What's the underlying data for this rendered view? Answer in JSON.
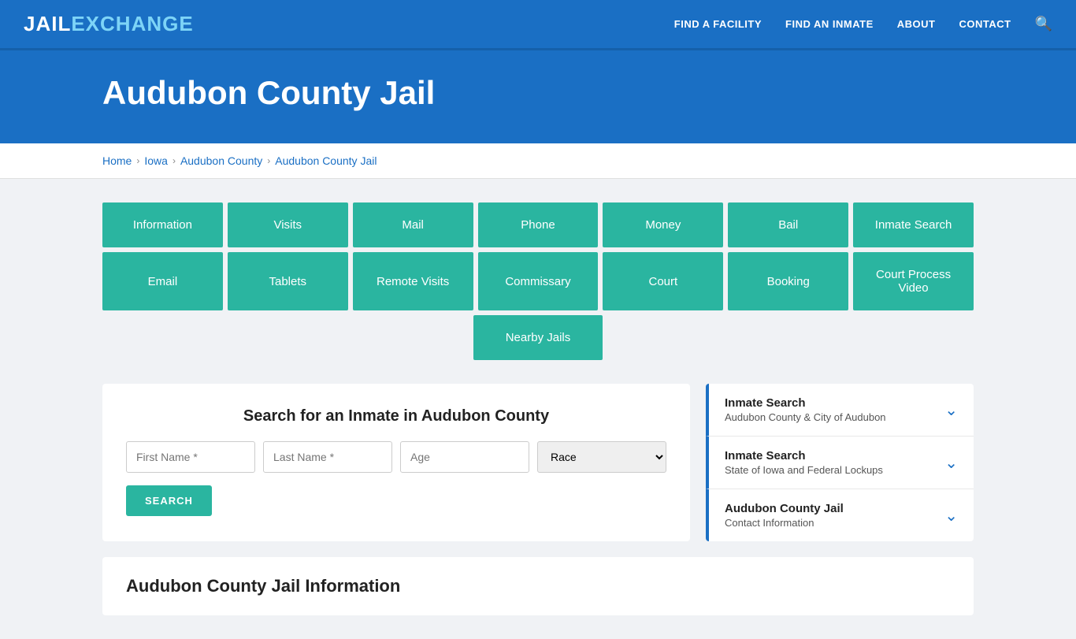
{
  "header": {
    "logo_jail": "JAIL",
    "logo_exchange": "EXCHANGE",
    "nav": [
      {
        "label": "FIND A FACILITY",
        "name": "find-facility"
      },
      {
        "label": "FIND AN INMATE",
        "name": "find-inmate"
      },
      {
        "label": "ABOUT",
        "name": "about"
      },
      {
        "label": "CONTACT",
        "name": "contact"
      }
    ]
  },
  "hero": {
    "title": "Audubon County Jail"
  },
  "breadcrumb": {
    "items": [
      "Home",
      "Iowa",
      "Audubon County",
      "Audubon County Jail"
    ]
  },
  "grid_row1": [
    "Information",
    "Visits",
    "Mail",
    "Phone",
    "Money",
    "Bail",
    "Inmate Search"
  ],
  "grid_row2": [
    "Email",
    "Tablets",
    "Remote Visits",
    "Commissary",
    "Court",
    "Booking",
    "Court Process Video"
  ],
  "grid_row3": "Nearby Jails",
  "search": {
    "title": "Search for an Inmate in Audubon County",
    "first_name_placeholder": "First Name *",
    "last_name_placeholder": "Last Name *",
    "age_placeholder": "Age",
    "race_placeholder": "Race",
    "button_label": "SEARCH"
  },
  "sidebar": {
    "cards": [
      {
        "title": "Inmate Search",
        "subtitle": "Audubon County & City of Audubon",
        "name": "inmate-search-county"
      },
      {
        "title": "Inmate Search",
        "subtitle": "State of Iowa and Federal Lockups",
        "name": "inmate-search-state"
      },
      {
        "title": "Audubon County Jail",
        "subtitle": "Contact Information",
        "name": "contact-information"
      }
    ]
  },
  "jail_info": {
    "title": "Audubon County Jail Information"
  }
}
